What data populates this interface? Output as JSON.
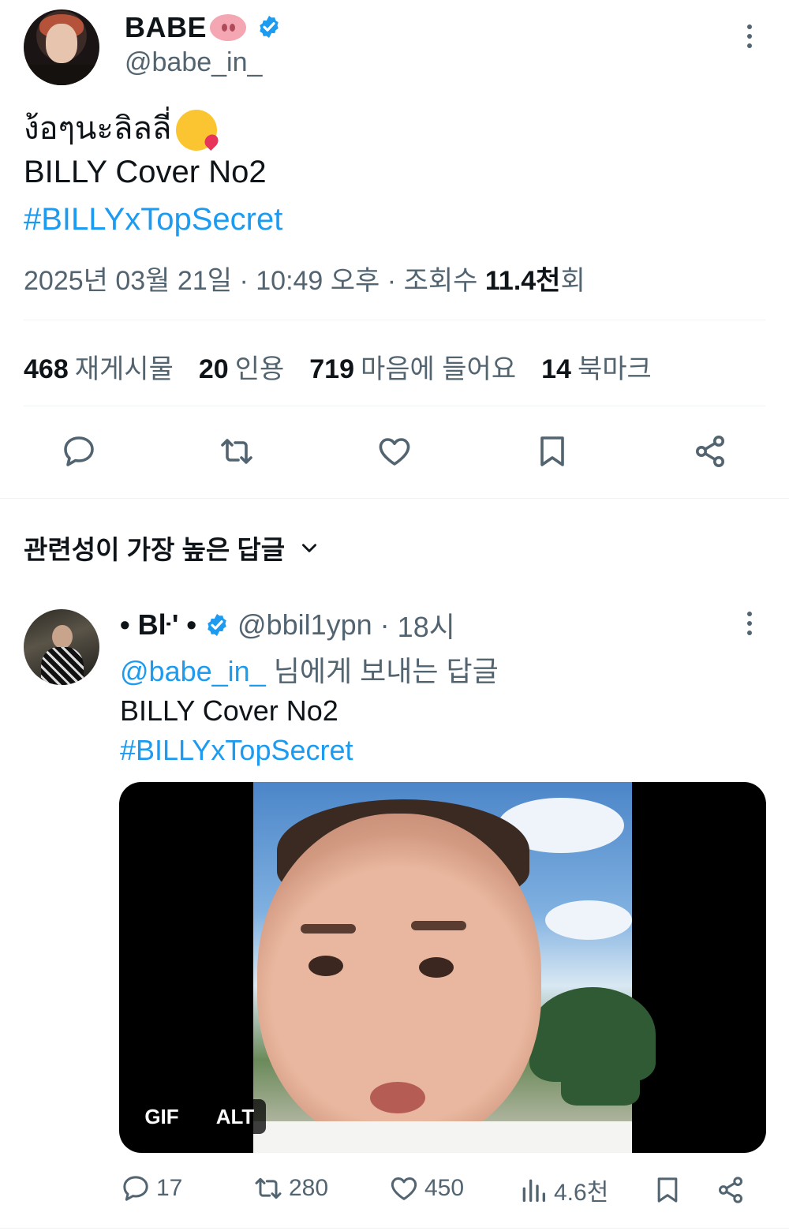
{
  "tweet": {
    "author_name": "BABE",
    "author_emoji": "pig-nose-emoji",
    "author_handle": "@babe_in_",
    "text_line1": "ง้อๆนะลิลลี่",
    "text_line1_emoji": "kissing-face-emoji",
    "text_line2": "BILLY Cover No2",
    "hashtag": "#BILLYxTopSecret",
    "date": "2025년 03월 21일",
    "time": "10:49 오후",
    "views_prefix": "조회수",
    "views_value": "11.4천",
    "views_suffix": "회",
    "separator": "·"
  },
  "stats": [
    {
      "value": "468",
      "label": "재게시물"
    },
    {
      "value": "20",
      "label": "인용"
    },
    {
      "value": "719",
      "label": "마음에 들어요"
    },
    {
      "value": "14",
      "label": "북마크"
    }
  ],
  "actions": [
    "reply-icon",
    "retweet-icon",
    "like-icon",
    "bookmark-icon",
    "share-icon"
  ],
  "replies_section": {
    "title": "관련성이 가장 높은 답글"
  },
  "reply": {
    "author_name": "• Bŀ' •",
    "author_handle": "@bbil1ypn",
    "time": "18시",
    "separator": "·",
    "replying_to_mention": "@babe_in_",
    "replying_to_suffix": "님에게 보내는 답글",
    "text": "BILLY Cover No2",
    "hashtag": "#BILLYxTopSecret",
    "media_badges": {
      "gif": "GIF",
      "alt": "ALT"
    },
    "counts": {
      "replies": "17",
      "retweets": "280",
      "likes": "450",
      "views": "4.6천"
    }
  },
  "colors": {
    "link": "#1d9bf0",
    "secondary_text": "#536471",
    "primary_text": "#0f1419",
    "divider": "#eff3f4"
  }
}
